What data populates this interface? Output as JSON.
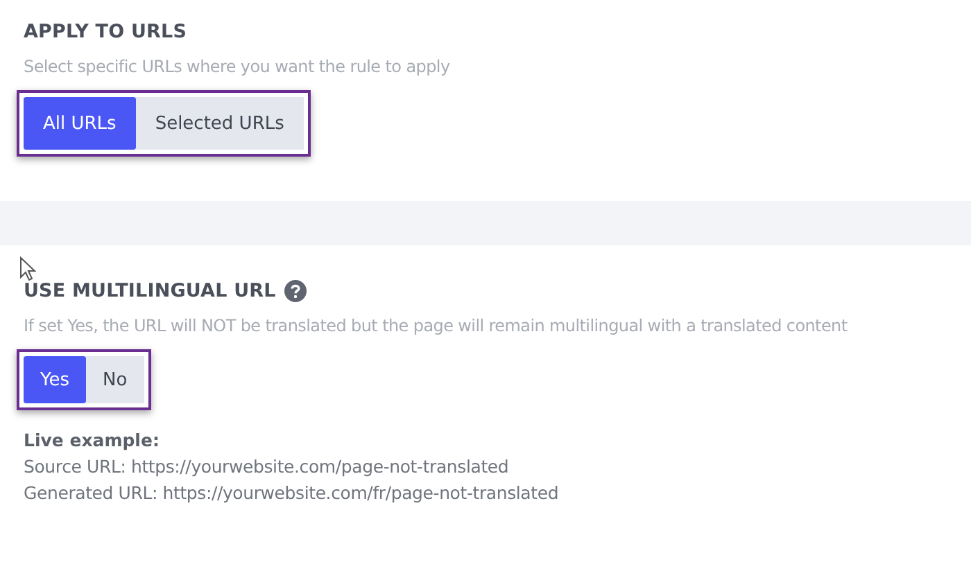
{
  "sections": [
    {
      "title": "APPLY TO URLS",
      "help": false,
      "description": "Select specific URLs where you want the rule to apply",
      "options": [
        {
          "label": "All URLs",
          "selected": true
        },
        {
          "label": "Selected URLs",
          "selected": false
        }
      ]
    },
    {
      "title": "USE MULTILINGUAL URL",
      "help": true,
      "description": "If set Yes, the URL will NOT be translated but the page will remain multilingual with a translated content",
      "options": [
        {
          "label": "Yes",
          "selected": true
        },
        {
          "label": "No",
          "selected": false
        }
      ],
      "example": {
        "heading": "Live example:",
        "lines": [
          "Source URL: https://yourwebsite.com/page-not-translated",
          "Generated URL: https://yourwebsite.com/fr/page-not-translated"
        ]
      }
    }
  ]
}
